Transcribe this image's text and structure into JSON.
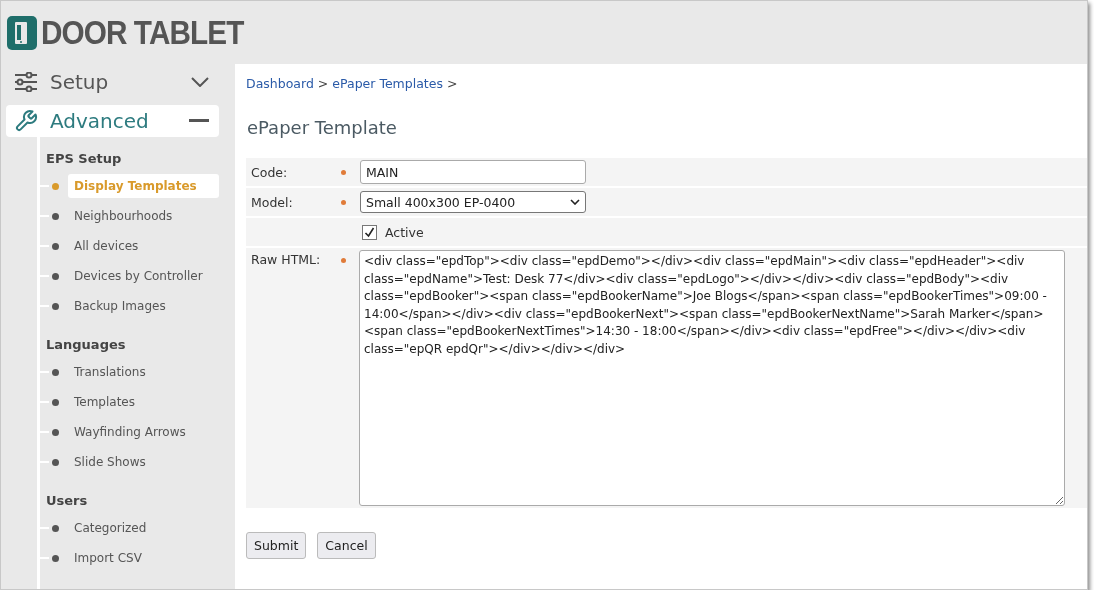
{
  "logo": {
    "text": "DOOR TABLET"
  },
  "sidebar": {
    "menus": [
      {
        "label": "Setup",
        "expanded": false
      },
      {
        "label": "Advanced",
        "expanded": true,
        "groups": [
          {
            "heading": "EPS Setup",
            "items": [
              {
                "label": "Display Templates",
                "selected": true
              },
              {
                "label": "Neighbourhoods",
                "selected": false
              },
              {
                "label": "All devices",
                "selected": false
              },
              {
                "label": "Devices by Controller",
                "selected": false
              },
              {
                "label": "Backup Images",
                "selected": false
              }
            ]
          },
          {
            "heading": "Languages",
            "items": [
              {
                "label": "Translations",
                "selected": false
              },
              {
                "label": "Templates",
                "selected": false
              },
              {
                "label": "Wayfinding Arrows",
                "selected": false
              },
              {
                "label": "Slide Shows",
                "selected": false
              }
            ]
          },
          {
            "heading": "Users",
            "items": [
              {
                "label": "Categorized",
                "selected": false
              },
              {
                "label": "Import CSV",
                "selected": false
              }
            ]
          }
        ]
      }
    ]
  },
  "breadcrumb": [
    {
      "kind": "link",
      "text": "Dashboard"
    },
    {
      "kind": "separator",
      "text": ">"
    },
    {
      "kind": "link",
      "text": "ePaper Templates"
    },
    {
      "kind": "separator",
      "text": ">"
    }
  ],
  "title": "ePaper Template",
  "form": {
    "fields": [
      {
        "kind": "text",
        "label": "Code:",
        "required": true,
        "value": "MAIN"
      },
      {
        "kind": "select",
        "label": "Model:",
        "required": true,
        "value": "Small 400x300 EP-0400"
      },
      {
        "kind": "checkbox",
        "label": "Active",
        "checked": true
      },
      {
        "kind": "textarea",
        "label": "Raw HTML:",
        "required": true,
        "value": "<div class=\"epdTop\"><div class=\"epdDemo\"></div><div class=\"epdMain\"><div class=\"epdHeader\"><div class=\"epdName\">Test: Desk 77</div><div class=\"epdLogo\"></div></div><div class=\"epdBody\"><div class=\"epdBooker\"><span class=\"epdBookerName\">Joe Blogs</span><span class=\"epdBookerTimes\">09:00 - 14:00</span></div><div class=\"epdBookerNext\"><span class=\"epdBookerNextName\">Sarah Marker</span><span class=\"epdBookerNextTimes\">14:30 - 18:00</span></div><div class=\"epdFree\"></div></div><div class=\"epQR epdQr\"></div></div></div>"
      }
    ],
    "buttons": [
      "Submit",
      "Cancel"
    ]
  }
}
